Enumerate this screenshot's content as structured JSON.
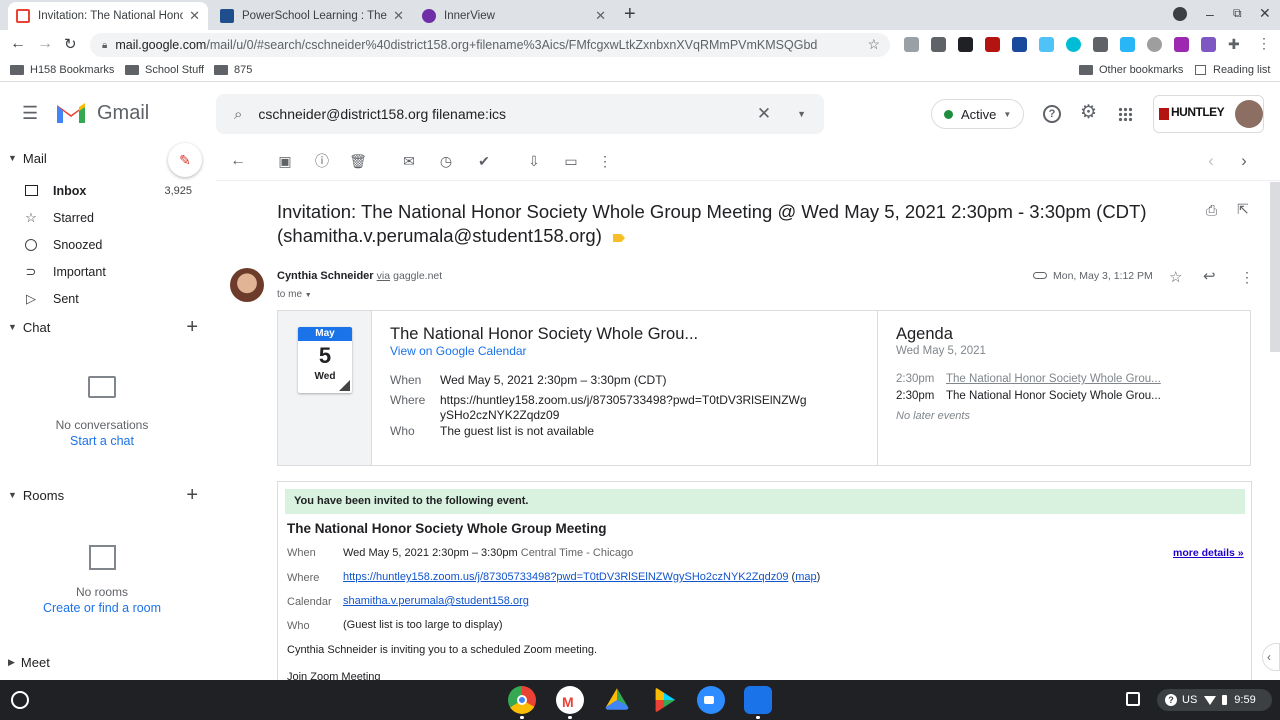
{
  "browser": {
    "tabs": [
      {
        "title": "Invitation: The National Honor S",
        "favicon_color": "#ea4335",
        "active": true
      },
      {
        "title": "PowerSchool Learning : The Nat",
        "favicon_color": "#1e4e8c",
        "active": false
      },
      {
        "title": "InnerView",
        "favicon_color": "#6f2da8",
        "active": false
      }
    ],
    "new_tab": "+",
    "url_host": "mail.google.com",
    "url_path": "/mail/u/0/#search/cschneider%40district158.org+filename%3Aics/FMfcgxwLtkZxnbxnXVqRMmPVmKMSQGbd",
    "bookmarks": [
      "H158 Bookmarks",
      "School Stuff",
      "875"
    ],
    "other_bookmarks": "Other bookmarks",
    "reading_list": "Reading list"
  },
  "gmail": {
    "logo_text": "Gmail",
    "search_value": "cschneider@district158.org filename:ics",
    "status": "Active",
    "org_name": "HUNTLEY"
  },
  "sidebar": {
    "mail_label": "Mail",
    "items": [
      {
        "label": "Inbox",
        "count": "3,925",
        "icon": "inbox-icon"
      },
      {
        "label": "Starred",
        "count": "",
        "icon": "star-icon"
      },
      {
        "label": "Snoozed",
        "count": "",
        "icon": "clock-icon"
      },
      {
        "label": "Important",
        "count": "",
        "icon": "important-icon"
      },
      {
        "label": "Sent",
        "count": "",
        "icon": "send-icon"
      }
    ],
    "chat_label": "Chat",
    "no_conversations": "No conversations",
    "start_chat": "Start a chat",
    "rooms_label": "Rooms",
    "no_rooms": "No rooms",
    "create_room": "Create or find a room",
    "meet_label": "Meet"
  },
  "email": {
    "subject": "Invitation: The National Honor Society Whole Group Meeting @ Wed May 5, 2021 2:30pm - 3:30pm (CDT) (shamitha.v.perumala@student158.org)",
    "sender": "Cynthia Schneider",
    "via": "via",
    "via_domain": "gaggle.net",
    "to": "to me",
    "date": "Mon, May 3, 1:12 PM",
    "card": {
      "month": "May",
      "day": "5",
      "weekday": "Wed",
      "title": "The National Honor Society Whole Grou...",
      "view_link": "View on Google Calendar",
      "when_label": "When",
      "when": "Wed May 5, 2021 2:30pm – 3:30pm (CDT)",
      "where_label": "Where",
      "where_line1": "https://huntley158.zoom.us/j/87305733498?pwd=T0tDV3RlSElNZWg",
      "where_line2": "ySHo2czNYK2Zqdz09",
      "who_label": "Who",
      "who": "The guest list is not available"
    },
    "agenda": {
      "title": "Agenda",
      "date": "Wed May 5, 2021",
      "events": [
        {
          "time": "2:30pm",
          "title": "The National Honor Society Whole Grou..."
        },
        {
          "time": "2:30pm",
          "title": "The National Honor Society Whole Grou..."
        }
      ],
      "no_later": "No later events"
    },
    "invite": {
      "banner": "You have been invited to the following event.",
      "title": "The National Honor Society Whole Group Meeting",
      "when_label": "When",
      "when": "Wed May 5, 2021 2:30pm – 3:30pm",
      "tz": "Central Time - Chicago",
      "more": "more details »",
      "where_label": "Where",
      "where": "https://huntley158.zoom.us/j/87305733498?pwd=T0tDV3RlSElNZWgySHo2czNYK2Zqdz09",
      "map": "map",
      "calendar_label": "Calendar",
      "calendar": "shamitha.v.perumala@student158.org",
      "who_label": "Who",
      "who": "(Guest list is too large to display)",
      "body1": "Cynthia Schneider is inviting you to a scheduled Zoom meeting.",
      "body2": "Join Zoom Meeting"
    }
  },
  "taskbar": {
    "locale": "US",
    "time": "9:59"
  }
}
